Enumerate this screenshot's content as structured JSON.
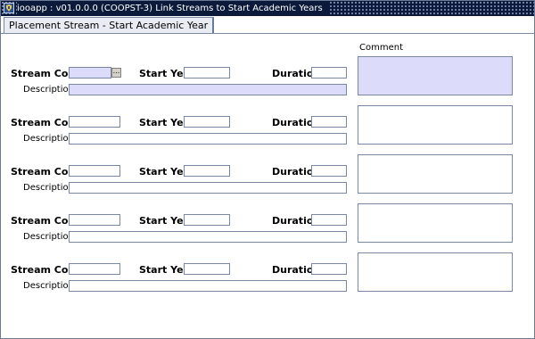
{
  "window": {
    "title": "iooapp : v01.0.0.0 (COOPST-3) Link Streams to Start Academic Years"
  },
  "tab": {
    "label": "Placement Stream - Start Academic Year"
  },
  "comment_heading": "Comment",
  "labels": {
    "stream_code": "Stream Code",
    "start_year": "Start Year",
    "duration": "Duration",
    "description": "Description"
  },
  "lov_button": "...",
  "records": [
    {
      "stream_code": "",
      "start_year": "",
      "duration": "",
      "description": "",
      "comment": "",
      "active": true
    },
    {
      "stream_code": "",
      "start_year": "",
      "duration": "",
      "description": "",
      "comment": "",
      "active": false
    },
    {
      "stream_code": "",
      "start_year": "",
      "duration": "",
      "description": "",
      "comment": "",
      "active": false
    },
    {
      "stream_code": "",
      "start_year": "",
      "duration": "",
      "description": "",
      "comment": "",
      "active": false
    },
    {
      "stream_code": "",
      "start_year": "",
      "duration": "",
      "description": "",
      "comment": "",
      "active": false
    }
  ]
}
